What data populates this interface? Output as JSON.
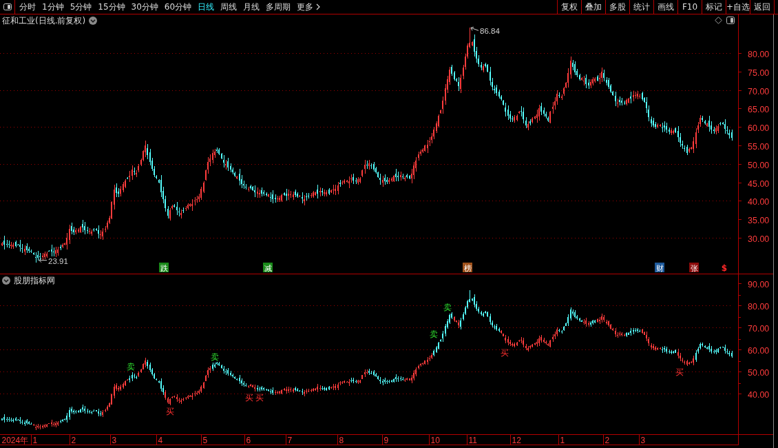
{
  "period_tabs": [
    {
      "label": "分时",
      "selected": false
    },
    {
      "label": "1分钟",
      "selected": false
    },
    {
      "label": "5分钟",
      "selected": false
    },
    {
      "label": "15分钟",
      "selected": false
    },
    {
      "label": "30分钟",
      "selected": false
    },
    {
      "label": "60分钟",
      "selected": false
    },
    {
      "label": "日线",
      "selected": true
    },
    {
      "label": "周线",
      "selected": false
    },
    {
      "label": "月线",
      "selected": false
    },
    {
      "label": "多周期",
      "selected": false
    }
  ],
  "more_menu": {
    "label": "更多"
  },
  "tool_buttons": [
    "复权",
    "叠加",
    "多股",
    "统计",
    "画线",
    "F10",
    "标记",
    "+自选",
    "返回"
  ],
  "main_chart": {
    "title": "征和工业(日线.前复权)",
    "price_axis": [
      "80.00",
      "75.00",
      "70.00",
      "65.00",
      "60.00",
      "55.00",
      "50.00",
      "45.00",
      "40.00",
      "35.00",
      "30.00"
    ],
    "price_labels": [
      "86.84",
      "23.91"
    ],
    "event_tags": [
      {
        "kind": "tag",
        "text": "跌",
        "color": "#1a8a1a"
      },
      {
        "kind": "tag",
        "text": "减",
        "color": "#1a8a1a"
      },
      {
        "kind": "tag",
        "text": "榜",
        "color": "#a0521c"
      },
      {
        "kind": "tag",
        "text": "财",
        "color": "#1e5a9c"
      },
      {
        "kind": "tag",
        "text": "张",
        "color": "#8c0c0c"
      },
      {
        "kind": "symbol",
        "text": "$",
        "color": "#ff2828"
      }
    ]
  },
  "indicator_panel": {
    "title": "股朋指标网",
    "value_axis": [
      "90.00",
      "80.00",
      "70.00",
      "60.00",
      "50.00",
      "40.00"
    ],
    "signals": [
      {
        "kind": "sell",
        "text": "卖"
      },
      {
        "kind": "buy",
        "text": "买"
      },
      {
        "kind": "sell",
        "text": "卖"
      },
      {
        "kind": "buy",
        "text": "买"
      },
      {
        "kind": "buy",
        "text": "买"
      },
      {
        "kind": "sell",
        "text": "卖"
      },
      {
        "kind": "sell",
        "text": "卖"
      },
      {
        "kind": "buy",
        "text": "买"
      },
      {
        "kind": "buy",
        "text": "买"
      }
    ]
  },
  "time_axis": [
    "2024年",
    "1",
    "2",
    "3",
    "4",
    "5",
    "6",
    "7",
    "8",
    "9",
    "10",
    "11",
    "12",
    "1",
    "2",
    "3"
  ]
}
